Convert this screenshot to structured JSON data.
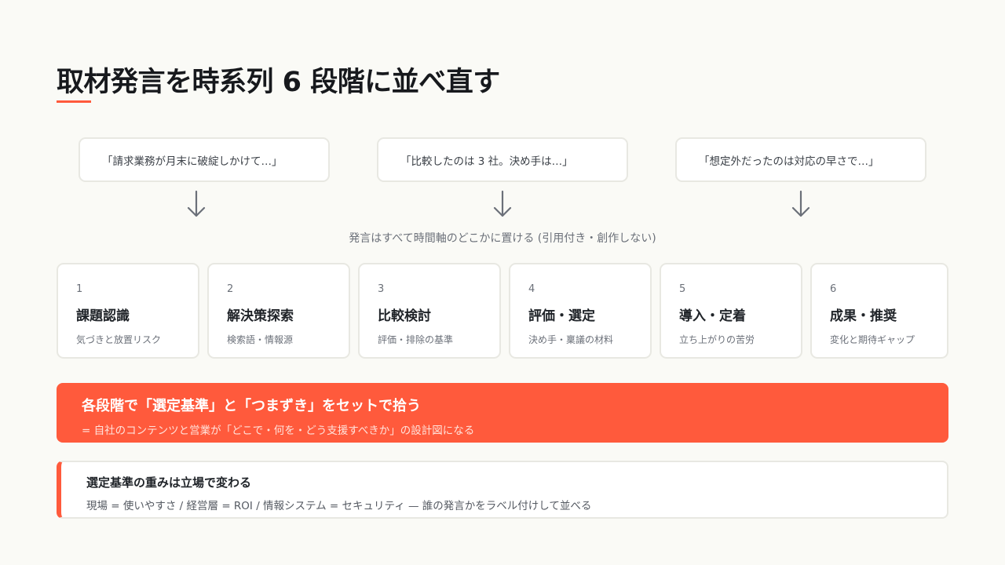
{
  "title": "取材発言を時系列 6 段階に並べ直す",
  "quotes": [
    "「請求業務が月末に破綻しかけて…」",
    "「比較したのは 3 社。決め手は…」",
    "「想定外だったのは対応の早さで…」"
  ],
  "caption": "発言はすべて時間軸のどこかに置ける (引用付き・創作しない)",
  "stages": [
    {
      "num": "1",
      "title": "課題認識",
      "sub": "気づきと放置リスク"
    },
    {
      "num": "2",
      "title": "解決策探索",
      "sub": "検索語・情報源"
    },
    {
      "num": "3",
      "title": "比較検討",
      "sub": "評価・排除の基準"
    },
    {
      "num": "4",
      "title": "評価・選定",
      "sub": "決め手・稟議の材料"
    },
    {
      "num": "5",
      "title": "導入・定着",
      "sub": "立ち上がりの苦労"
    },
    {
      "num": "6",
      "title": "成果・推奨",
      "sub": "変化と期待ギャップ"
    }
  ],
  "banner": {
    "heading": "各段階で「選定基準」と「つまずき」をセットで拾う",
    "sub": "= 自社のコンテンツと営業が「どこで・何を・どう支援すべきか」の設計図になる"
  },
  "note": {
    "heading": "選定基準の重みは立場で変わる",
    "sub": "現場 = 使いやすさ / 経営層 = ROI / 情報システム = セキュリティ — 誰の発言かをラベル付けして並べる"
  },
  "colors": {
    "accent": "#ff5a3c",
    "background": "#fafaf6",
    "arrow": "#6b7079"
  }
}
